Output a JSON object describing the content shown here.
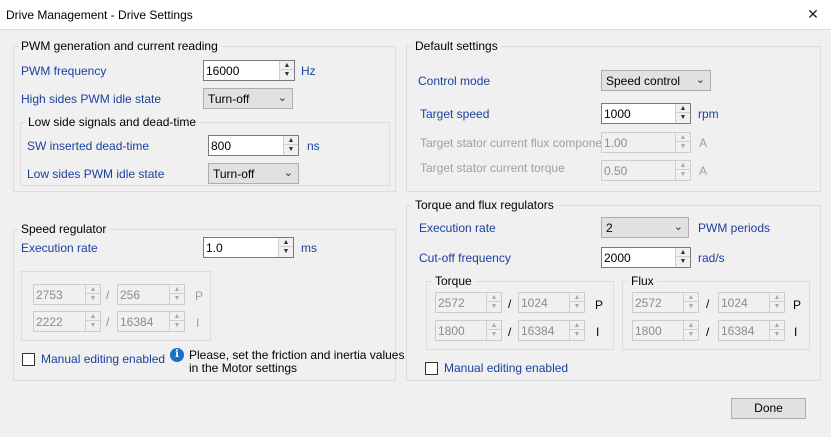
{
  "window": {
    "title": "Drive Management - Drive Settings",
    "close": "✕"
  },
  "pwm": {
    "group_label": "PWM generation and current reading",
    "frequency_label": "PWM frequency",
    "frequency_value": "16000",
    "frequency_unit": "Hz",
    "high_side_label": "High sides PWM idle state",
    "high_side_value": "Turn-off",
    "low_side_group_label": "Low side signals and dead-time",
    "dead_time_label": "SW inserted dead-time",
    "dead_time_value": "800",
    "dead_time_unit": "ns",
    "low_side_label": "Low sides PWM idle state",
    "low_side_value": "Turn-off"
  },
  "speed_regulator": {
    "group_label": "Speed regulator",
    "exec_rate_label": "Execution rate",
    "exec_rate_value": "1.0",
    "exec_rate_unit": "ms",
    "p_num": "2753",
    "p_den": "256",
    "i_num": "2222",
    "i_den": "16384",
    "p_label": "P",
    "i_label": "I",
    "slash": "/",
    "manual_label": "Manual editing enabled",
    "info_text_1": "Please, set the friction and inertia values",
    "info_text_2": "in the Motor settings"
  },
  "defaults": {
    "group_label": "Default settings",
    "control_mode_label": "Control mode",
    "control_mode_value": "Speed control",
    "target_speed_label": "Target speed",
    "target_speed_value": "1000",
    "target_speed_unit": "rpm",
    "flux_label": "Target stator current flux component",
    "flux_value": "1.00",
    "flux_unit": "A",
    "torque_label": "Target stator current torque",
    "torque_value": "0.50",
    "torque_unit": "A"
  },
  "torque_flux": {
    "group_label": "Torque and flux regulators",
    "exec_rate_label": "Execution rate",
    "exec_rate_value": "2",
    "exec_rate_unit": "PWM periods",
    "cutoff_label": "Cut-off frequency",
    "cutoff_value": "2000",
    "cutoff_unit": "rad/s",
    "torque_group": "Torque",
    "torque_p_num": "2572",
    "torque_p_den": "1024",
    "torque_i_num": "1800",
    "torque_i_den": "16384",
    "flux_group": "Flux",
    "flux_p_num": "2572",
    "flux_p_den": "1024",
    "flux_i_num": "1800",
    "flux_i_den": "16384",
    "p_label": "P",
    "i_label": "I",
    "slash": "/",
    "manual_label": "Manual editing enabled"
  },
  "buttons": {
    "done": "Done"
  },
  "glyphs": {
    "up": "▲",
    "down": "▼",
    "chevron": "⌄",
    "info": "i"
  }
}
